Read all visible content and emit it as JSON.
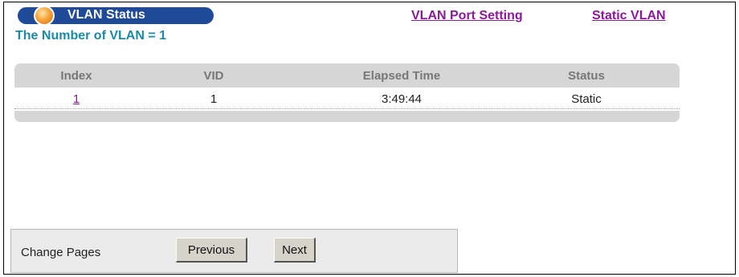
{
  "header": {
    "title": "VLAN Status",
    "vlan_count_text": "The Number of VLAN = 1",
    "links": {
      "port_setting": "VLAN Port Setting",
      "static_vlan": "Static VLAN"
    }
  },
  "table": {
    "columns": [
      "Index",
      "VID",
      "Elapsed Time",
      "Status"
    ],
    "rows": [
      {
        "index": "1",
        "vid": "1",
        "elapsed": "3:49:44",
        "status": "Static"
      }
    ]
  },
  "pager": {
    "label": "Change Pages",
    "previous": "Previous",
    "next": "Next"
  },
  "colors": {
    "title_bar": "#1e4a98",
    "count_text": "#1a8aa6",
    "link": "#8a1a99",
    "table_header_bg": "#d6d6d6",
    "pager_bg": "#ebebeb"
  },
  "icons": {
    "title_orb": "orange-orb-icon"
  }
}
